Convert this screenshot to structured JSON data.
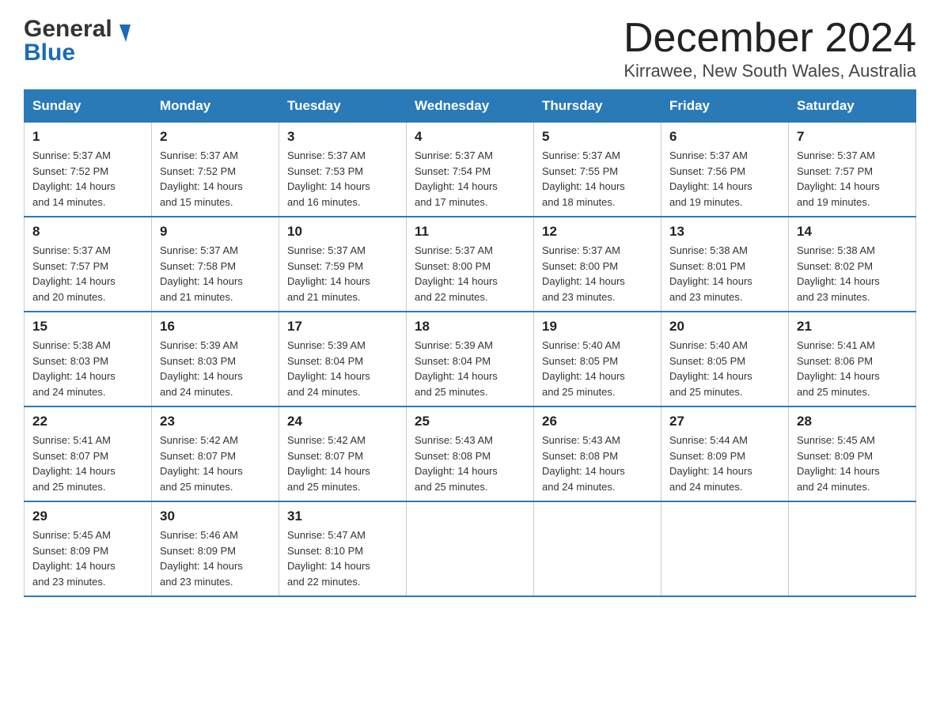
{
  "header": {
    "month_title": "December 2024",
    "location": "Kirrawee, New South Wales, Australia",
    "logo_general": "General",
    "logo_blue": "Blue"
  },
  "weekdays": [
    "Sunday",
    "Monday",
    "Tuesday",
    "Wednesday",
    "Thursday",
    "Friday",
    "Saturday"
  ],
  "weeks": [
    [
      {
        "day": "1",
        "sunrise": "5:37 AM",
        "sunset": "7:52 PM",
        "daylight": "14 hours and 14 minutes."
      },
      {
        "day": "2",
        "sunrise": "5:37 AM",
        "sunset": "7:52 PM",
        "daylight": "14 hours and 15 minutes."
      },
      {
        "day": "3",
        "sunrise": "5:37 AM",
        "sunset": "7:53 PM",
        "daylight": "14 hours and 16 minutes."
      },
      {
        "day": "4",
        "sunrise": "5:37 AM",
        "sunset": "7:54 PM",
        "daylight": "14 hours and 17 minutes."
      },
      {
        "day": "5",
        "sunrise": "5:37 AM",
        "sunset": "7:55 PM",
        "daylight": "14 hours and 18 minutes."
      },
      {
        "day": "6",
        "sunrise": "5:37 AM",
        "sunset": "7:56 PM",
        "daylight": "14 hours and 19 minutes."
      },
      {
        "day": "7",
        "sunrise": "5:37 AM",
        "sunset": "7:57 PM",
        "daylight": "14 hours and 19 minutes."
      }
    ],
    [
      {
        "day": "8",
        "sunrise": "5:37 AM",
        "sunset": "7:57 PM",
        "daylight": "14 hours and 20 minutes."
      },
      {
        "day": "9",
        "sunrise": "5:37 AM",
        "sunset": "7:58 PM",
        "daylight": "14 hours and 21 minutes."
      },
      {
        "day": "10",
        "sunrise": "5:37 AM",
        "sunset": "7:59 PM",
        "daylight": "14 hours and 21 minutes."
      },
      {
        "day": "11",
        "sunrise": "5:37 AM",
        "sunset": "8:00 PM",
        "daylight": "14 hours and 22 minutes."
      },
      {
        "day": "12",
        "sunrise": "5:37 AM",
        "sunset": "8:00 PM",
        "daylight": "14 hours and 23 minutes."
      },
      {
        "day": "13",
        "sunrise": "5:38 AM",
        "sunset": "8:01 PM",
        "daylight": "14 hours and 23 minutes."
      },
      {
        "day": "14",
        "sunrise": "5:38 AM",
        "sunset": "8:02 PM",
        "daylight": "14 hours and 23 minutes."
      }
    ],
    [
      {
        "day": "15",
        "sunrise": "5:38 AM",
        "sunset": "8:03 PM",
        "daylight": "14 hours and 24 minutes."
      },
      {
        "day": "16",
        "sunrise": "5:39 AM",
        "sunset": "8:03 PM",
        "daylight": "14 hours and 24 minutes."
      },
      {
        "day": "17",
        "sunrise": "5:39 AM",
        "sunset": "8:04 PM",
        "daylight": "14 hours and 24 minutes."
      },
      {
        "day": "18",
        "sunrise": "5:39 AM",
        "sunset": "8:04 PM",
        "daylight": "14 hours and 25 minutes."
      },
      {
        "day": "19",
        "sunrise": "5:40 AM",
        "sunset": "8:05 PM",
        "daylight": "14 hours and 25 minutes."
      },
      {
        "day": "20",
        "sunrise": "5:40 AM",
        "sunset": "8:05 PM",
        "daylight": "14 hours and 25 minutes."
      },
      {
        "day": "21",
        "sunrise": "5:41 AM",
        "sunset": "8:06 PM",
        "daylight": "14 hours and 25 minutes."
      }
    ],
    [
      {
        "day": "22",
        "sunrise": "5:41 AM",
        "sunset": "8:07 PM",
        "daylight": "14 hours and 25 minutes."
      },
      {
        "day": "23",
        "sunrise": "5:42 AM",
        "sunset": "8:07 PM",
        "daylight": "14 hours and 25 minutes."
      },
      {
        "day": "24",
        "sunrise": "5:42 AM",
        "sunset": "8:07 PM",
        "daylight": "14 hours and 25 minutes."
      },
      {
        "day": "25",
        "sunrise": "5:43 AM",
        "sunset": "8:08 PM",
        "daylight": "14 hours and 25 minutes."
      },
      {
        "day": "26",
        "sunrise": "5:43 AM",
        "sunset": "8:08 PM",
        "daylight": "14 hours and 24 minutes."
      },
      {
        "day": "27",
        "sunrise": "5:44 AM",
        "sunset": "8:09 PM",
        "daylight": "14 hours and 24 minutes."
      },
      {
        "day": "28",
        "sunrise": "5:45 AM",
        "sunset": "8:09 PM",
        "daylight": "14 hours and 24 minutes."
      }
    ],
    [
      {
        "day": "29",
        "sunrise": "5:45 AM",
        "sunset": "8:09 PM",
        "daylight": "14 hours and 23 minutes."
      },
      {
        "day": "30",
        "sunrise": "5:46 AM",
        "sunset": "8:09 PM",
        "daylight": "14 hours and 23 minutes."
      },
      {
        "day": "31",
        "sunrise": "5:47 AM",
        "sunset": "8:10 PM",
        "daylight": "14 hours and 22 minutes."
      },
      null,
      null,
      null,
      null
    ]
  ],
  "labels": {
    "sunrise": "Sunrise:",
    "sunset": "Sunset:",
    "daylight": "Daylight:"
  }
}
